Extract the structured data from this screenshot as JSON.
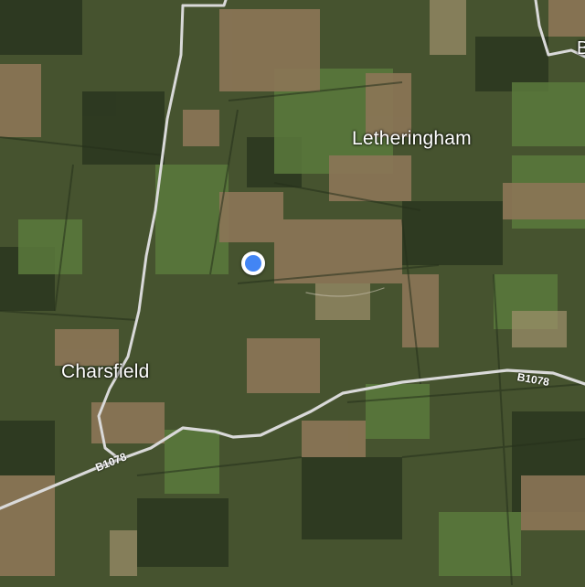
{
  "map": {
    "labels": {
      "letheringham": "Letheringham",
      "charsfield": "Charsfield"
    },
    "roads": {
      "b1078_west": "B1078",
      "b1078_east": "B1078"
    },
    "edge_label": "B",
    "location_marker": {
      "icon": "my-location-dot-icon",
      "color": "#4285f4"
    },
    "colors": {
      "road": "#d9d9d9",
      "field_dark": "#2f3d22",
      "field_green": "#4f6a35",
      "field_brown": "#8a7556"
    }
  }
}
